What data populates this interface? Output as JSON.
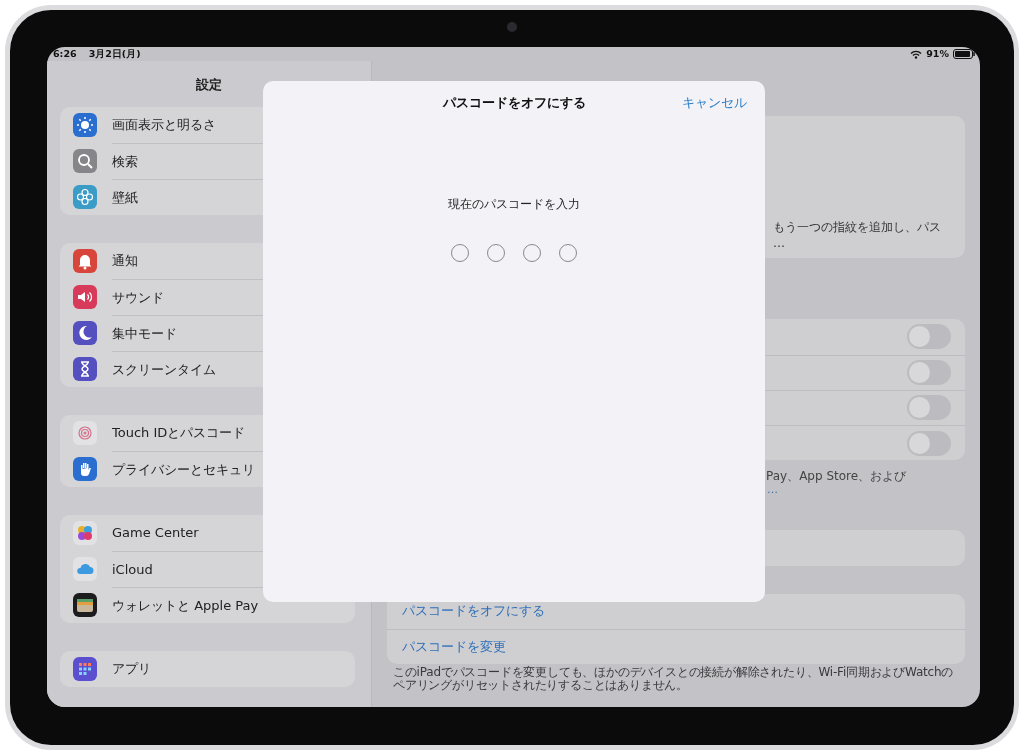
{
  "status_bar": {
    "time": "6:26",
    "date": "3月2日(月)",
    "battery": "91%"
  },
  "sidebar": {
    "title": "設定",
    "groups": [
      {
        "items": [
          {
            "label": "画面表示と明るさ",
            "color": "#2a6fd0"
          },
          {
            "label": "検索",
            "color": "#86868a"
          },
          {
            "label": "壁紙",
            "color": "#3c9cc8"
          }
        ]
      },
      {
        "items": [
          {
            "label": "通知",
            "color": "#d8453a"
          },
          {
            "label": "サウンド",
            "color": "#d83a5a"
          },
          {
            "label": "集中モード",
            "color": "#5550c0"
          },
          {
            "label": "スクリーンタイム",
            "color": "#5550c0"
          }
        ]
      },
      {
        "items": [
          {
            "label": "Touch IDとパスコード",
            "color": "#e2e2e4"
          },
          {
            "label": "プライバシーとセキュリ",
            "color": "#2a6fd0"
          }
        ]
      },
      {
        "items": [
          {
            "label": "Game Center",
            "color": "#e2e2e4"
          },
          {
            "label": "iCloud",
            "color": "#e2e2e4"
          },
          {
            "label": "ウォレットと Apple Pay",
            "color": "#1c1c1e"
          }
        ]
      },
      {
        "items": [
          {
            "label": "アプリ",
            "color": "#5a4fcf"
          }
        ]
      }
    ]
  },
  "detail": {
    "card_text": "もう一つの指紋を追加し、パス",
    "card_more": "…",
    "toggles": [
      {
        "on": false
      },
      {
        "on": false
      },
      {
        "on": false
      },
      {
        "on": false
      }
    ],
    "note": "Pay、App Store、および",
    "note_link": "…",
    "actions": [
      "パスコードをオフにする",
      "パスコードを変更"
    ],
    "footnote": [
      "このiPadでパスコードを変更しても、ほかのデバイスとの接続が解除されたり、Wi-Fi同期およびWatchの",
      "ペアリングがリセットされたりすることはありません。"
    ]
  },
  "dialog": {
    "title": "パスコードをオフにする",
    "cancel": "キャンセル",
    "prompt": "現在のパスコードを入力",
    "digits": [
      {
        "filled": false
      },
      {
        "filled": false
      },
      {
        "filled": false
      },
      {
        "filled": false
      }
    ]
  }
}
